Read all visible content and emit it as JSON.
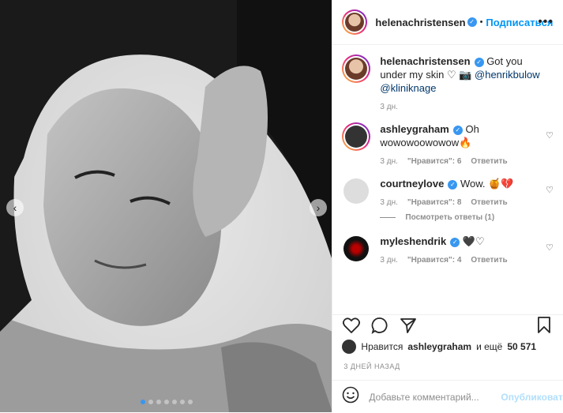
{
  "header": {
    "username": "helenachristensen",
    "separator": "•",
    "follow_label": "Подписаться",
    "more_label": "•••"
  },
  "post": {
    "username": "helenachristensen",
    "caption_text": "Got you under my skin ♡ 📷",
    "mention1": "@henrikbulow",
    "mention2": "@kliniknage",
    "time": "3 дн."
  },
  "comments": [
    {
      "username": "ashleygraham",
      "text": "Oh wowowoowowow🔥",
      "time": "3 дн.",
      "likes": "\"Нравится\": 6",
      "reply": "Ответить"
    },
    {
      "username": "courtneylove",
      "text": "Wow. 🍯💔",
      "time": "3 дн.",
      "likes": "\"Нравится\": 8",
      "reply": "Ответить",
      "view_replies": "Посмотреть ответы (1)"
    },
    {
      "username": "myleshendrik",
      "text": "🖤♡",
      "time": "3 дн.",
      "likes": "\"Нравится\": 4",
      "reply": "Ответить"
    }
  ],
  "likes_line": {
    "prefix": "Нравится",
    "user": "ashleygraham",
    "middle": "и ещё",
    "count": "50 571"
  },
  "time_ago": "3 ДНЕЙ НАЗАД",
  "add_comment": {
    "placeholder": "Добавьте комментарий...",
    "publish_label": "Опубликовать"
  },
  "carousel": {
    "slides": 7,
    "active": 1
  },
  "colors": {
    "accent": "#0095f6",
    "verified": "#3897f0",
    "muted": "#8e8e8e"
  }
}
